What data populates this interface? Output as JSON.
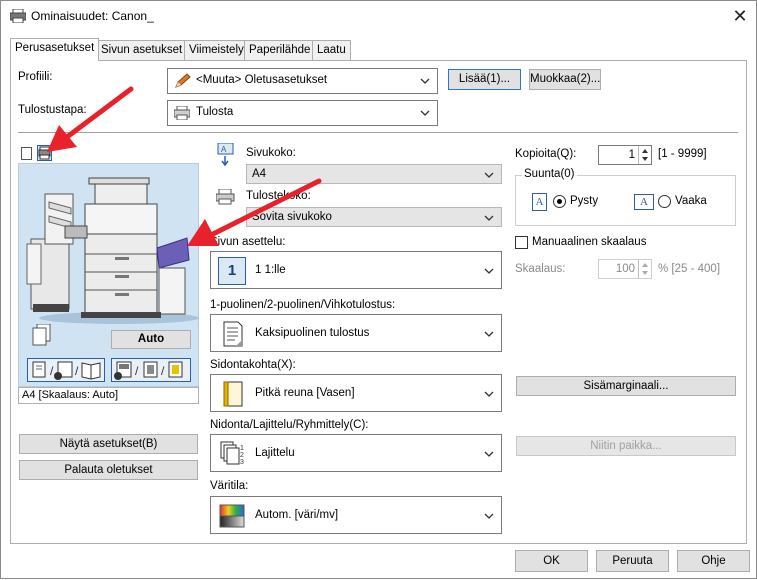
{
  "window": {
    "title": "Ominaisuudet: Canon_",
    "close_symbol": "✕"
  },
  "tabs": [
    {
      "label": "Perusasetukset",
      "active": true
    },
    {
      "label": "Sivun asetukset",
      "active": false
    },
    {
      "label": "Viimeistely",
      "active": false
    },
    {
      "label": "Paperilähde",
      "active": false
    },
    {
      "label": "Laatu",
      "active": false
    }
  ],
  "profile": {
    "label": "Profiili:",
    "value": "<Muuta> Oletusasetukset",
    "add_button": "Lisää(1)...",
    "edit_button": "Muokkaa(2)..."
  },
  "output": {
    "label": "Tulostustapa:",
    "value": "Tulosta"
  },
  "preview": {
    "auto_button": "Auto",
    "status": "A4 [Skaalaus: Auto]"
  },
  "left_buttons": {
    "show_settings": "Näytä asetukset(B)",
    "restore_defaults": "Palauta oletukset"
  },
  "page_size": {
    "label": "Sivukoko:",
    "value": "A4"
  },
  "output_size": {
    "label": "Tulostekoko:",
    "value": "Sovita sivukoko"
  },
  "page_layout": {
    "label": "Sivun asettelu:",
    "icon_number": "1",
    "value": "1 1:lle"
  },
  "duplex": {
    "label": "1-puolinen/2-puolinen/Vihkotulostus:",
    "value": "Kaksipuolinen tulostus"
  },
  "binding": {
    "label": "Sidontakohta(X):",
    "value": "Pitkä reuna [Vasen]"
  },
  "finishing": {
    "label": "Nidonta/Lajittelu/Ryhmittely(C):",
    "value": "Lajittelu"
  },
  "color_mode": {
    "label": "Väritila:",
    "value": "Autom. [väri/mv]"
  },
  "copies": {
    "label": "Kopioita(Q):",
    "value": "1",
    "range": "[1 - 9999]"
  },
  "orientation": {
    "label": "Suunta(0)",
    "icon_letter": "A",
    "portrait": "Pysty",
    "landscape": "Vaaka",
    "selected": "portrait"
  },
  "scaling": {
    "manual_label": "Manuaalinen skaalaus",
    "manual_checked": false,
    "label": "Skaalaus:",
    "value": "100",
    "range": "% [25 - 400]"
  },
  "buttons": {
    "gutter": "Sisämarginaali...",
    "staple_position": "Niitin paikka...",
    "ok": "OK",
    "cancel": "Peruuta",
    "help": "Ohje"
  },
  "colors": {
    "arrow": "#e8212b",
    "preview_bg": "#cfe3f3",
    "accent": "#2a5fa8"
  }
}
